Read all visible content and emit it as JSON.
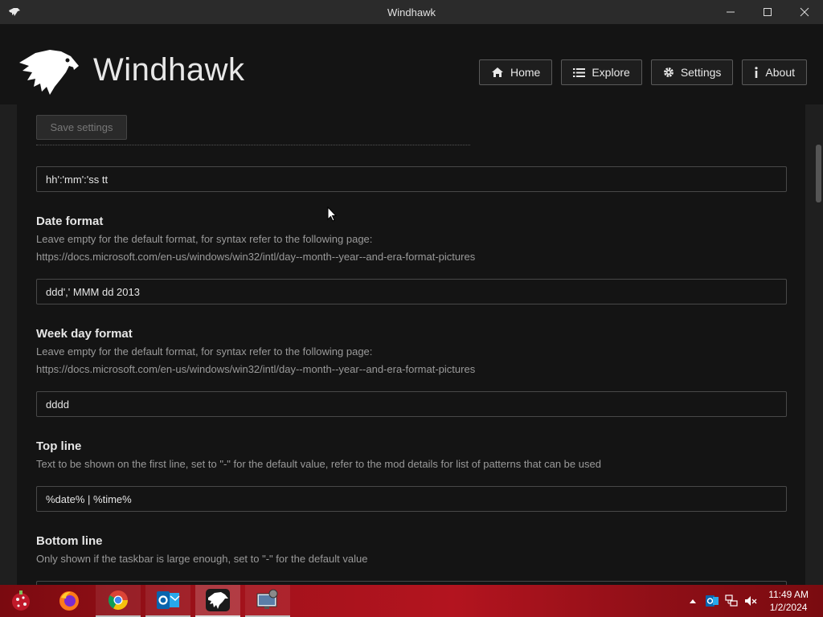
{
  "window": {
    "title": "Windhawk",
    "controls": {
      "minimize": "minimize-icon",
      "maximize": "maximize-icon",
      "close": "close-icon"
    }
  },
  "header": {
    "brand": "Windhawk",
    "nav": [
      {
        "label": "Home",
        "icon": "home-icon"
      },
      {
        "label": "Explore",
        "icon": "list-icon"
      },
      {
        "label": "Settings",
        "icon": "gear-icon"
      },
      {
        "label": "About",
        "icon": "info-icon"
      }
    ]
  },
  "settings": {
    "save_label": "Save settings",
    "time_format_value": "hh':'mm':'ss tt",
    "fields": [
      {
        "title": "Date format",
        "desc_line1": "Leave empty for the default format, for syntax refer to the following page:",
        "desc_line2": "https://docs.microsoft.com/en-us/windows/win32/intl/day--month--year--and-era-format-pictures",
        "value": "ddd',' MMM dd 2013"
      },
      {
        "title": "Week day format",
        "desc_line1": "Leave empty for the default format, for syntax refer to the following page:",
        "desc_line2": "https://docs.microsoft.com/en-us/windows/win32/intl/day--month--year--and-era-format-pictures",
        "value": "dddd"
      },
      {
        "title": "Top line",
        "desc_line1": "Text to be shown on the first line, set to \"-\" for the default value, refer to the mod details for list of patterns that can be used",
        "value": "%date% | %time%"
      },
      {
        "title": "Bottom line",
        "desc_line1": "Only shown if the taskbar is large enough, set to \"-\" for the default value"
      }
    ]
  },
  "taskbar": {
    "apps": [
      "start-icon",
      "firefox-icon",
      "chrome-icon",
      "outlook-icon",
      "windhawk-icon",
      "network-monitor-icon"
    ],
    "time": "11:49 AM",
    "date": "1/2/2024"
  },
  "colors": {
    "background": "#1f1f1f",
    "panel": "#141414",
    "taskbar": "#a3121b",
    "muted_text": "#9a9a9a"
  }
}
